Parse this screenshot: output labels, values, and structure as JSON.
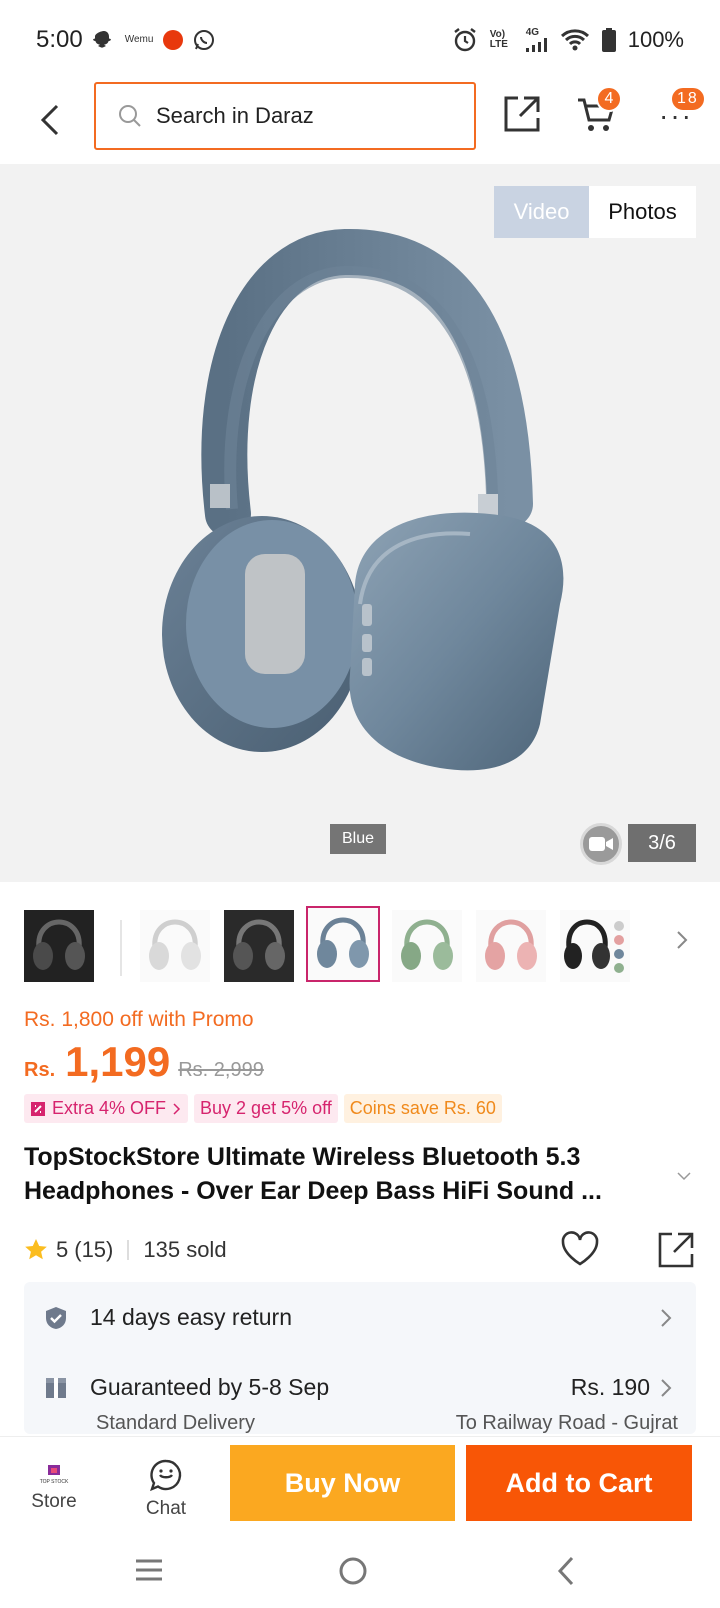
{
  "status_bar": {
    "time": "5:00",
    "app_label": "Wemu",
    "volte_label": "Vo) LTE",
    "network": "4G",
    "battery": "100%"
  },
  "header": {
    "search_placeholder": "Search in Daraz",
    "cart_count": "4",
    "more_count": "18"
  },
  "gallery": {
    "tabs": [
      "Video",
      "Photos"
    ],
    "active_tab": "Video",
    "color_label": "Blue",
    "counter": "3/6",
    "thumbnails": [
      "dark",
      "silver",
      "dark",
      "blue",
      "green",
      "pink",
      "black-multi"
    ],
    "selected_thumbnail": 3
  },
  "pricing": {
    "promo_text": "Rs. 1,800 off with Promo",
    "currency": "Rs.",
    "price": "1,199",
    "old_price": "Rs. 2,999",
    "chips": [
      {
        "label": "Extra 4% OFF",
        "icon": "voucher-icon"
      },
      {
        "label": "Buy 2 get 5% off"
      },
      {
        "label": "Coins save Rs. 60"
      }
    ]
  },
  "product": {
    "title": "TopStockStore Ultimate Wireless Bluetooth 5.3 Headphones - Over Ear Deep Bass HiFi Sound ...",
    "rating": "5",
    "reviews": "(15)",
    "sold": "135 sold"
  },
  "services": {
    "return_label": "14 days easy return",
    "delivery_label": "Guaranteed by 5-8 Sep",
    "delivery_price": "Rs. 190",
    "delivery_type": "Standard Delivery",
    "delivery_to": "To Railway Road - Gujrat"
  },
  "actions": {
    "store_label": "Store",
    "store_logo_text": "TOP STOCK",
    "chat_label": "Chat",
    "buy_now": "Buy Now",
    "add_to_cart": "Add to Cart"
  },
  "colors": {
    "accent": "#f36b21",
    "buy_now": "#fba820",
    "add_to_cart": "#f85606",
    "chip_pink": "#d6246e"
  }
}
